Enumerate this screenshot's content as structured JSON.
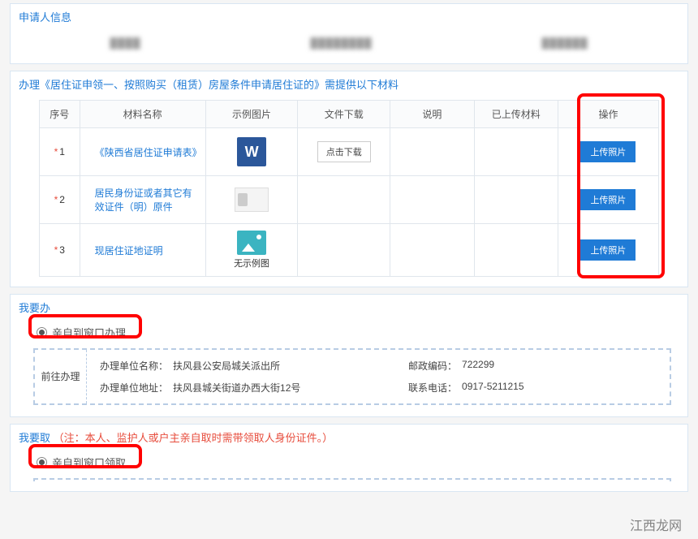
{
  "applicant": {
    "title": "申请人信息"
  },
  "materials": {
    "title": "办理《居住证申领一、按照购买（租赁）房屋条件申请居住证的》需提供以下材料",
    "headers": {
      "seq": "序号",
      "name": "材料名称",
      "sample": "示例图片",
      "download": "文件下载",
      "desc": "说明",
      "uploaded": "已上传材料",
      "action": "操作"
    },
    "download_btn": "点击下载",
    "upload_btn": "上传照片",
    "no_sample": "无示例图",
    "rows": [
      {
        "seq": "1",
        "name": "《陕西省居住证申请表》",
        "sample": "word",
        "download": true
      },
      {
        "seq": "2",
        "name": "居民身份证或者其它有效证件（明）原件",
        "sample": "id",
        "download": false
      },
      {
        "seq": "3",
        "name": "现居住证地证明",
        "sample": "none",
        "download": false
      }
    ]
  },
  "apply": {
    "title": "我要办",
    "radio": "亲自到窗口办理",
    "side_label": "前往办理",
    "unit_name_label": "办理单位名称：",
    "unit_name": "扶风县公安局城关派出所",
    "postal_label": "邮政编码：",
    "postal": "722299",
    "addr_label": "办理单位地址：",
    "addr": "扶风县城关街道办西大街12号",
    "phone_label": "联系电话：",
    "phone": "0917-5211215"
  },
  "pickup": {
    "title_main": "我要取",
    "title_note": "（注：本人、监护人或户主亲自取时需带领取人身份证件。）",
    "radio": "亲自到窗口领取"
  },
  "watermark": "江西龙网"
}
